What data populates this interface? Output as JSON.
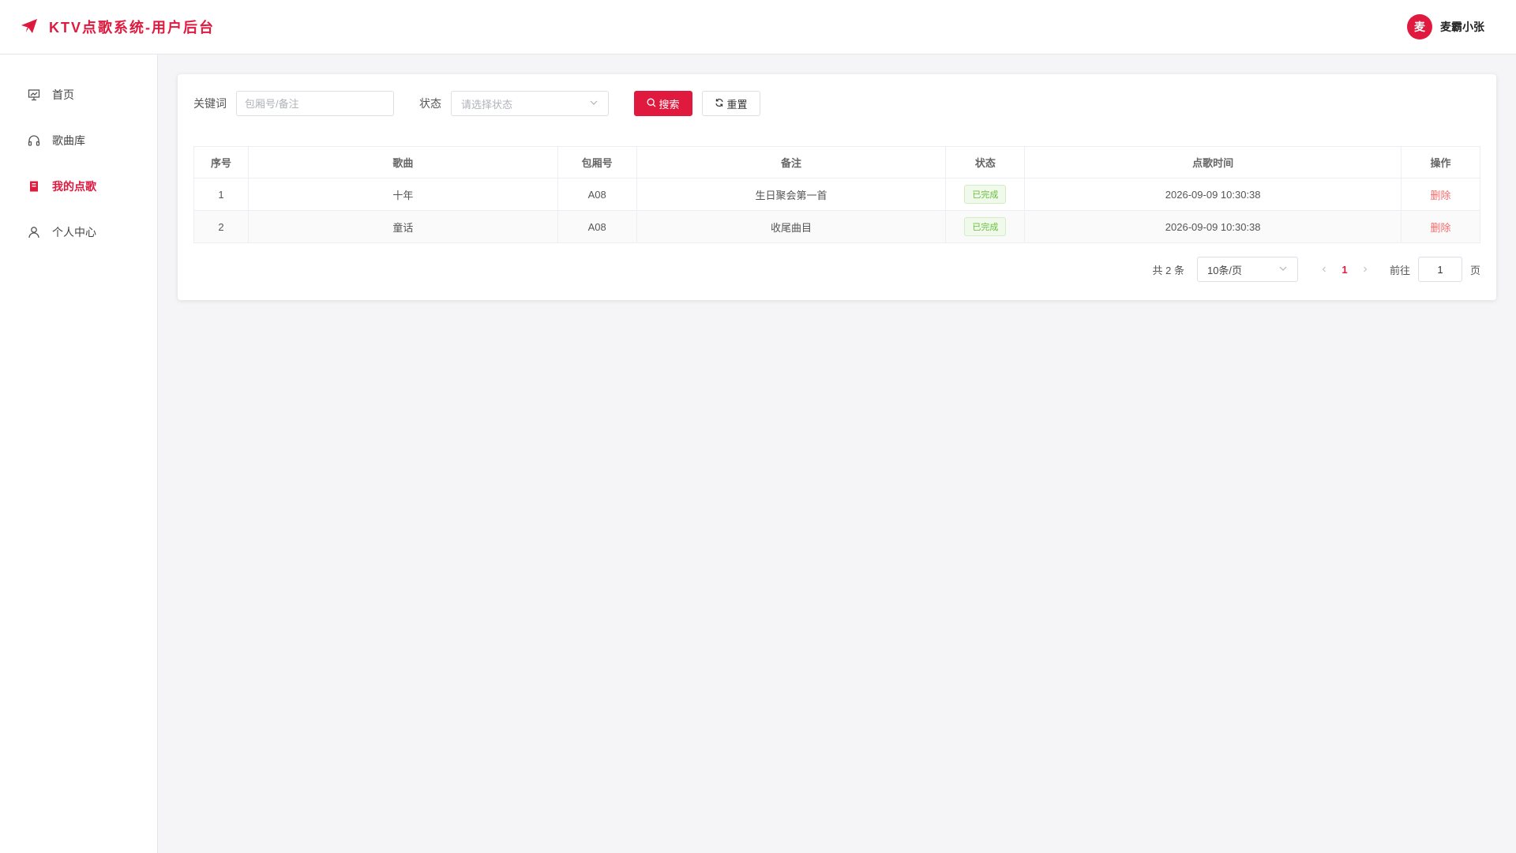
{
  "app": {
    "title": "KTV点歌系统-用户后台"
  },
  "user": {
    "avatar_text": "麦",
    "name": "麦霸小张"
  },
  "sidebar": {
    "items": [
      {
        "label": "首页",
        "icon": "presentation-icon",
        "active": false
      },
      {
        "label": "歌曲库",
        "icon": "headset-icon",
        "active": false
      },
      {
        "label": "我的点歌",
        "icon": "tickets-icon",
        "active": true
      },
      {
        "label": "个人中心",
        "icon": "user-icon",
        "active": false
      }
    ]
  },
  "filters": {
    "keyword_label": "关键词",
    "keyword_placeholder": "包厢号/备注",
    "status_label": "状态",
    "status_placeholder": "请选择状态",
    "search_label": "搜索",
    "reset_label": "重置"
  },
  "table": {
    "headers": [
      "序号",
      "歌曲",
      "包厢号",
      "备注",
      "状态",
      "点歌时间",
      "操作"
    ],
    "rows": [
      {
        "index": "1",
        "song": "十年",
        "room": "A08",
        "note": "生日聚会第一首",
        "status": "已完成",
        "time": "2026-09-09 10:30:38",
        "action": "删除"
      },
      {
        "index": "2",
        "song": "童话",
        "room": "A08",
        "note": "收尾曲目",
        "status": "已完成",
        "time": "2026-09-09 10:30:38",
        "action": "删除"
      }
    ]
  },
  "pagination": {
    "total_text": "共 2 条",
    "page_size": "10条/页",
    "current_page": "1",
    "goto_label": "前往",
    "goto_value": "1",
    "page_suffix": "页"
  },
  "colors": {
    "accent": "#e0193e",
    "success": "#67c23a",
    "danger": "#f56c6c"
  }
}
